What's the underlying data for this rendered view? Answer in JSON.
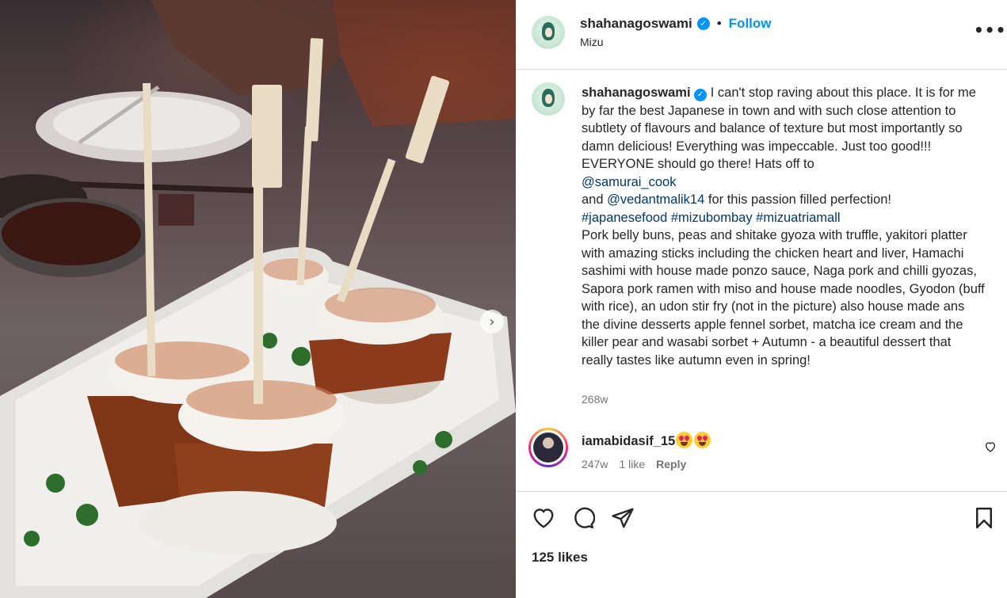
{
  "post": {
    "next_arrow": "›",
    "next_icon": "chevron-right-icon"
  },
  "header": {
    "username": "shahanagoswami",
    "verified_icon": "verified-badge-icon",
    "separator": "•",
    "follow_label": "Follow",
    "location": "Mizu",
    "more_label": "•••"
  },
  "caption": {
    "username": "shahanagoswami",
    "text_1": "I can't stop raving about this place. It is for me by far the best Japanese in town and with such close attention to subtlety of flavours and balance of texture but most importantly so damn delicious! Everything was impeccable. Just too good!!! EVERYONE should go there! Hats off to",
    "mention_1": "@samurai_cook",
    "and_word": "and",
    "mention_2": "@vedantmalik14",
    "text_2": "for this passion filled perfection!",
    "hashtags": [
      "#japanesefood",
      "#mizubombay",
      "#mizuatriamall"
    ],
    "text_3": "Pork belly buns, peas and shitake gyoza with truffle, yakitori platter with amazing sticks including the chicken heart and liver, Hamachi sashimi with house made ponzo sauce, Naga pork and chilli gyozas, Sapora pork ramen with miso and house made noodles, Gyodon (buff with rice), an udon stir fry (not in the picture) also house made ans the divine desserts apple fennel sorbet, matcha ice cream and the killer pear and wasabi sorbet + Autumn - a beautiful dessert that really tastes like autumn even in spring!",
    "time": "268w"
  },
  "comment": {
    "username": "iamabidasif_15",
    "emoji_icon": "heart-eyes-emoji",
    "time": "247w",
    "likes": "1 like",
    "reply_label": "Reply"
  },
  "actions": {
    "like_icon": "heart-icon",
    "comment_icon": "comment-icon",
    "share_icon": "share-icon",
    "save_icon": "bookmark-icon",
    "likes_count": "125 likes"
  },
  "colors": {
    "link": "#00376b",
    "follow": "#0095f6",
    "muted": "#737373"
  }
}
